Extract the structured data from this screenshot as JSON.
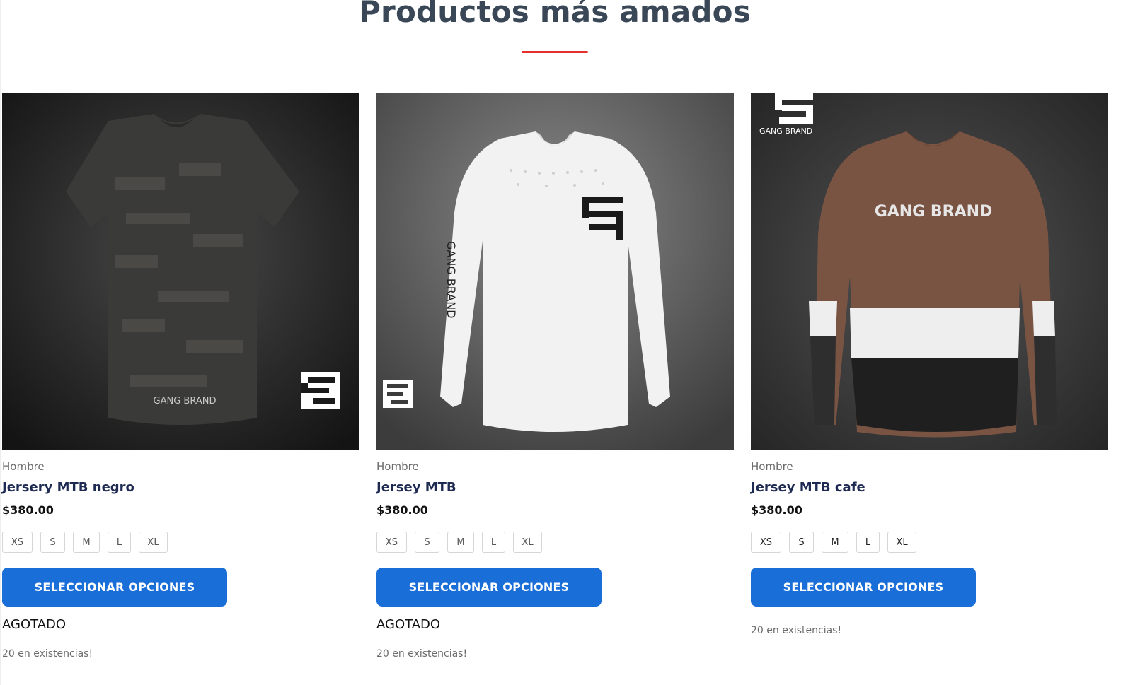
{
  "section": {
    "title": "Productos más amados"
  },
  "products": [
    {
      "category": "Hombre",
      "name": "Jersery MTB negro",
      "price": "$380.00",
      "sizes": [
        "XS",
        "S",
        "M",
        "L",
        "XL"
      ],
      "button_label": "SELECCIONAR OPCIONES",
      "status": "AGOTADO",
      "stock": "20 en existencias!",
      "image_brand_text": "GANG BRAND"
    },
    {
      "category": "Hombre",
      "name": "Jersey MTB",
      "price": "$380.00",
      "sizes": [
        "XS",
        "S",
        "M",
        "L",
        "XL"
      ],
      "button_label": "SELECCIONAR OPCIONES",
      "status": "AGOTADO",
      "stock": "20 en existencias!",
      "image_brand_text": "GANG BRAND"
    },
    {
      "category": "Hombre",
      "name": "Jersey MTB cafe",
      "price": "$380.00",
      "sizes": [
        "XS",
        "S",
        "M",
        "L",
        "XL"
      ],
      "button_label": "SELECCIONAR OPCIONES",
      "stock": "20 en existencias!",
      "image_brand_text": "GANG BRAND"
    }
  ],
  "colors": {
    "accent_underline": "#e5302f",
    "button": "#1a6ed8",
    "title": "#3a4757",
    "product_name": "#1e2a52"
  }
}
